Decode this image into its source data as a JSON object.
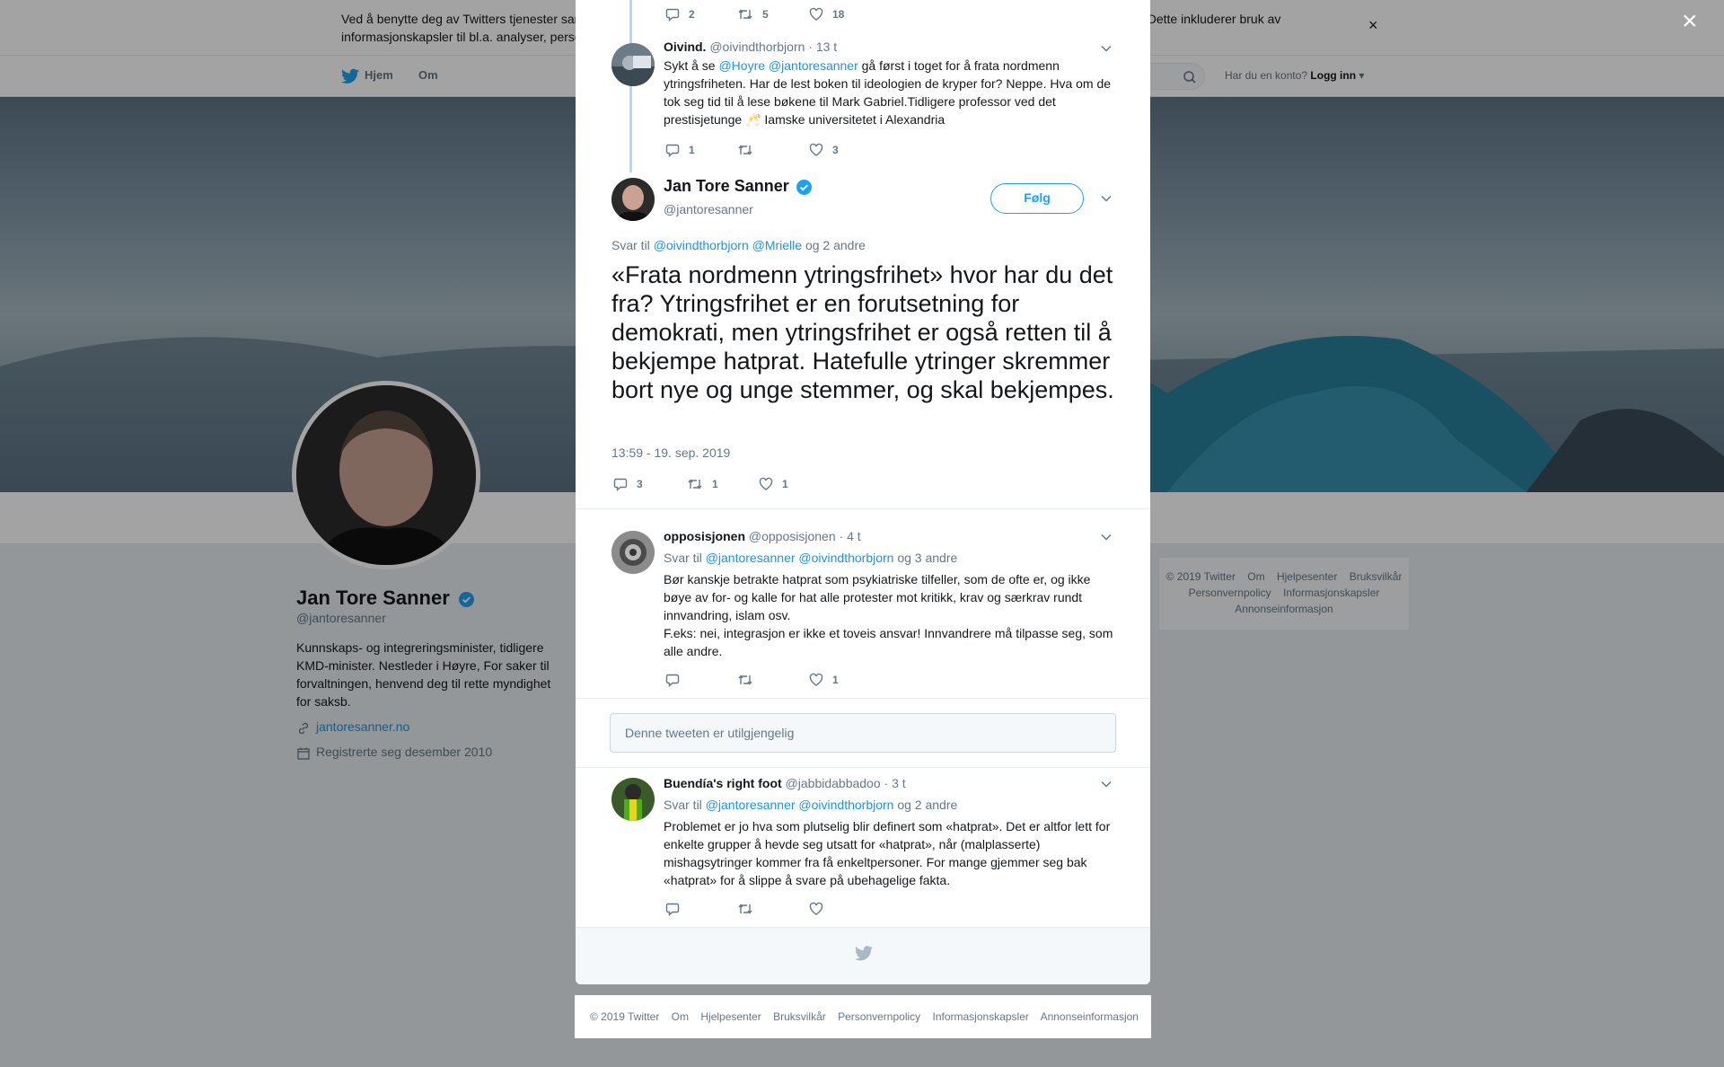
{
  "cookie": {
    "text": "Ved å benytte deg av Twitters tjenester samtykker du i vår bruk av informasjonskapsler og at data samles inn og brukes av oss og våre partnere. Dette inkluderer bruk av informasjonskapsler til bl.a. analyser, personalisering og annonser.",
    "close": "×"
  },
  "nav": {
    "home": "Hjem",
    "about": "Om",
    "account_prompt": "Har du en konto?",
    "login": "Logg inn"
  },
  "profile": {
    "name": "Jan Tore Sanner",
    "handle": "@jantoresanner",
    "bio": "Kunnskaps- og integreringsminister, tidligere KMD-minister. Nestleder i Høyre, For saker til forvaltningen, henvend deg til rette myndighet for saksb.",
    "link": "jantoresanner.no",
    "joined": "Registrerte seg desember 2010"
  },
  "side_footer": {
    "items": [
      "© 2019 Twitter",
      "Om",
      "Hjelpesenter",
      "Bruksvilkår",
      "Personvernpolicy",
      "Informasjonskapsler",
      "Annonseinformasjon"
    ]
  },
  "overlay_close": "×",
  "thread": {
    "prev_actions": {
      "replies": "2",
      "retweets": "5",
      "likes": "18"
    },
    "oivind": {
      "name": "Oivind.",
      "handle": "@oivindthorbjorn",
      "time": "· 13 t",
      "text_pre": "Sykt å se ",
      "mention1": "@Hoyre",
      "mention2": "@jantoresanner",
      "text_post": " gå først i toget for å frata nordmenn ytringsfriheten. Har de lest boken til ideologien de kryper for? Neppe. Hva om de tok seg tid til å lese bøkene til Mark Gabriel.Tidligere professor ved det prestisjetunge ",
      "emoji": "🥂",
      "text_end": " Iamske universitetet i Alexandria",
      "replies": "1",
      "retweets": "",
      "likes": "3"
    },
    "main": {
      "name": "Jan Tore Sanner",
      "handle": "@jantoresanner",
      "follow": "Følg",
      "reply_prefix": "Svar til",
      "reply_mention1": "@oivindthorbjorn",
      "reply_mention2": "@Mrielle",
      "reply_suffix": "og 2 andre",
      "text": "«Frata nordmenn ytringsfrihet» hvor har du det fra? Ytringsfrihet er en forutsetning for demokrati, men ytringsfrihet er også retten til å bekjempe hatprat. Hatefulle ytringer skremmer bort nye og unge stemmer, og skal bekjempes.",
      "timestamp": "13:59 - 19. sep. 2019",
      "replies": "3",
      "retweets": "1",
      "likes": "1"
    },
    "opp": {
      "name": "opposisjonen",
      "handle": "@opposisjonen",
      "time": "· 4 t",
      "reply_prefix": "Svar til",
      "reply_mention1": "@jantoresanner",
      "reply_mention2": "@oivindthorbjorn",
      "reply_suffix": "og 3 andre",
      "text1": "Bør kanskje betrakte hatprat som psykiatriske tilfeller, som de ofte er, og ikke bøye av for- og kalle for hat alle protester mot kritikk, krav og særkrav rundt innvandring, islam osv.",
      "text2": "F.eks: nei, integrasjon er ikke et toveis ansvar! Innvandrere må tilpasse seg, som alle andre.",
      "replies": "",
      "retweets": "",
      "likes": "1"
    },
    "unavailable": "Denne tweeten er utilgjengelig",
    "buendia": {
      "name": "Buendía's right foot",
      "handle": "@jabbidabbadoo",
      "time": "· 3 t",
      "reply_prefix": "Svar til",
      "reply_mention1": "@jantoresanner",
      "reply_mention2": "@oivindthorbjorn",
      "reply_suffix": "og 2 andre",
      "text": "Problemet er jo hva som plutselig blir definert som «hatprat». Det er altfor lett for enkelte grupper å hevde seg utsatt for «hatprat», når (malplasserte) mishagsytringer kommer fra få enkeltpersoner. For mange gjemmer seg bak «hatprat» for å slippe å svare på ubehagelige fakta."
    }
  },
  "bottom_footer": {
    "items": [
      "© 2019 Twitter",
      "Om",
      "Hjelpesenter",
      "Bruksvilkår",
      "Personvernpolicy",
      "Informasjonskapsler",
      "Annonseinformasjon"
    ]
  },
  "colors": {
    "accent": "#1da1f2",
    "link": "#1b95e0",
    "thread_line": "#aed9ff",
    "verified": "#1da1f2"
  }
}
